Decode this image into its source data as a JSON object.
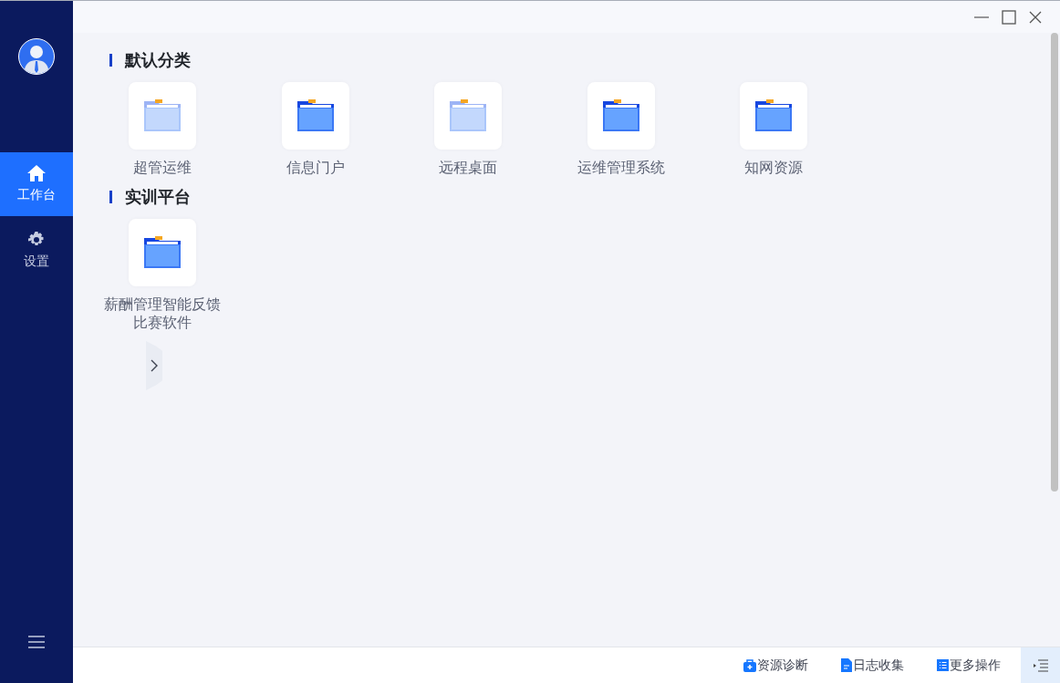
{
  "sidebar": {
    "items": [
      {
        "label": "工作台",
        "kind": "home",
        "selected": true
      },
      {
        "label": "设置",
        "kind": "gear",
        "selected": false
      }
    ]
  },
  "sections": [
    {
      "title": "默认分类",
      "apps": [
        {
          "label": "超管运维",
          "kind": "light"
        },
        {
          "label": "信息门户",
          "kind": "dark"
        },
        {
          "label": "远程桌面",
          "kind": "light"
        },
        {
          "label": "运维管理系统",
          "kind": "dark"
        },
        {
          "label": "知网资源",
          "kind": "dark"
        }
      ]
    },
    {
      "title": "实训平台",
      "apps": [
        {
          "label": "薪酬管理智能反馈比赛软件",
          "kind": "dark"
        }
      ]
    }
  ],
  "status_bar": {
    "actions": [
      {
        "label": "资源诊断",
        "kind": "kit"
      },
      {
        "label": "日志收集",
        "kind": "doc"
      },
      {
        "label": "更多操作",
        "kind": "list"
      }
    ]
  }
}
